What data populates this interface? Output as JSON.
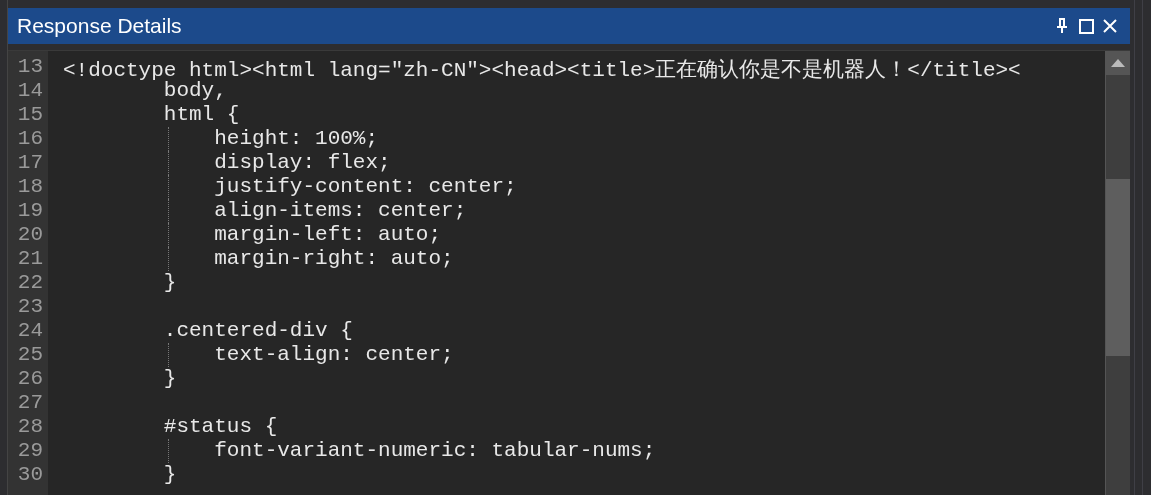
{
  "window": {
    "title": "Response Details"
  },
  "editor": {
    "lines": [
      {
        "number": "13",
        "text": "<!doctype html><html lang=\"zh-CN\"><head><title>正在确认你是不是机器人！</title><",
        "guide": false
      },
      {
        "number": "14",
        "text": "        body,",
        "guide": false
      },
      {
        "number": "15",
        "text": "        html {",
        "guide": false
      },
      {
        "number": "16",
        "text": "            height: 100%;",
        "guide": true
      },
      {
        "number": "17",
        "text": "            display: flex;",
        "guide": true
      },
      {
        "number": "18",
        "text": "            justify-content: center;",
        "guide": true
      },
      {
        "number": "19",
        "text": "            align-items: center;",
        "guide": true
      },
      {
        "number": "20",
        "text": "            margin-left: auto;",
        "guide": true
      },
      {
        "number": "21",
        "text": "            margin-right: auto;",
        "guide": true
      },
      {
        "number": "22",
        "text": "        }",
        "guide": false
      },
      {
        "number": "23",
        "guide": false
      },
      {
        "number": "24",
        "text": "        .centered-div {",
        "guide": false
      },
      {
        "number": "25",
        "text": "            text-align: center;",
        "guide": true
      },
      {
        "number": "26",
        "text": "        }",
        "guide": false
      },
      {
        "number": "27",
        "guide": false
      },
      {
        "number": "28",
        "text": "        #status {",
        "guide": false
      },
      {
        "number": "29",
        "text": "            font-variant-numeric: tabular-nums;",
        "guide": true
      },
      {
        "number": "30",
        "text": "        }",
        "guide": false
      }
    ]
  }
}
